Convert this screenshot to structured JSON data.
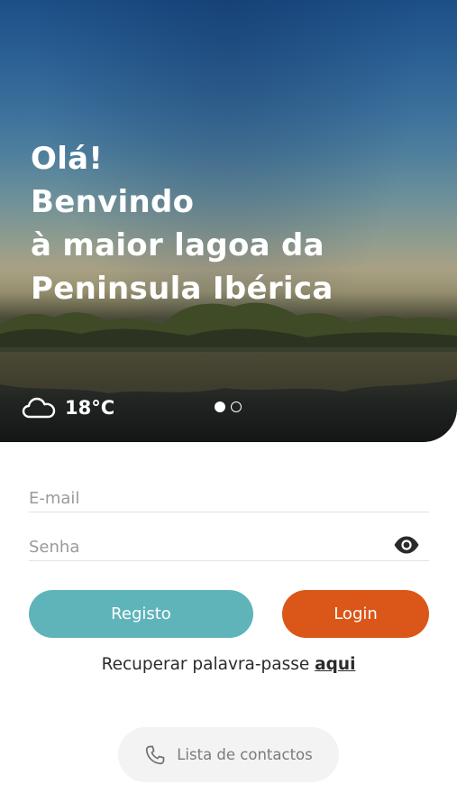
{
  "hero": {
    "title_lines": [
      "Olá!",
      "Benvindo",
      "à maior lagoa da",
      "Peninsula Ibérica"
    ],
    "weather": {
      "icon": "cloud-icon",
      "temperature": "18°C"
    },
    "carousel": {
      "count": 2,
      "active_index": 0
    }
  },
  "form": {
    "email": {
      "placeholder": "E-mail",
      "value": ""
    },
    "password": {
      "placeholder": "Senha",
      "value": "",
      "toggle_icon": "eye-icon"
    }
  },
  "actions": {
    "register_label": "Registo",
    "login_label": "Login"
  },
  "recover": {
    "prefix": "Recuperar palavra-passe ",
    "link_label": "aqui"
  },
  "contacts": {
    "icon": "phone-icon",
    "label": "Lista de contactos"
  },
  "colors": {
    "register": "#5fb4ba",
    "login": "#db5619",
    "contacts_bg": "#f3f3f3"
  }
}
